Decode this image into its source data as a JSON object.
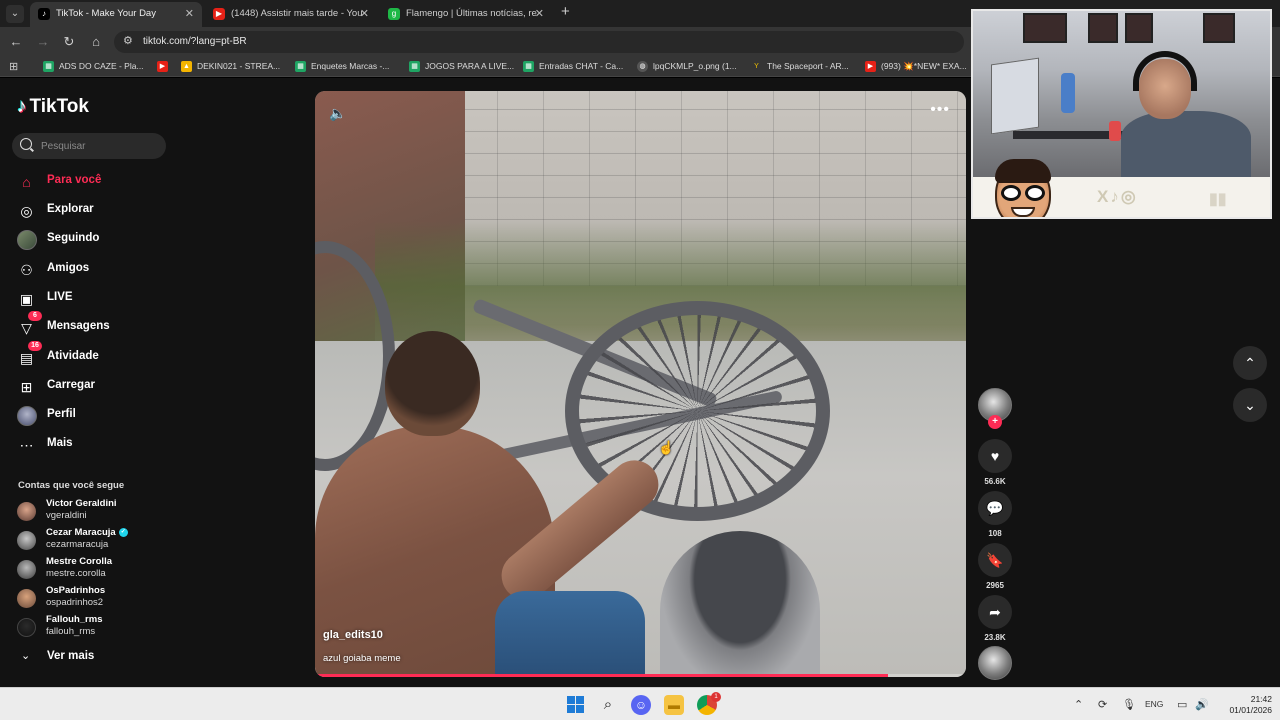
{
  "browser": {
    "tabs": [
      {
        "title": "TikTok - Make Your Day",
        "active": true,
        "favicon": "tiktok-icon"
      },
      {
        "title": "(1448) Assistir mais tarde - You",
        "active": false,
        "favicon": "youtube-icon"
      },
      {
        "title": "Flamengo | Últimas notícias, re",
        "active": false,
        "favicon": "ge-icon"
      }
    ],
    "url": "tiktok.com/?lang=pt-BR",
    "bookmarks": [
      {
        "label": "ADS DO CAZE - Pla...",
        "icon": "sheets-icon"
      },
      {
        "label": "",
        "icon": "youtube-icon"
      },
      {
        "label": "DEKIN021 - STREA...",
        "icon": "drive-icon"
      },
      {
        "label": "Enquetes Marcas -...",
        "icon": "sheets-icon"
      },
      {
        "label": "JOGOS PARA A LIVE...",
        "icon": "sheets-icon"
      },
      {
        "label": "Entradas CHAT - Ca...",
        "icon": "sheets-icon"
      },
      {
        "label": "lpqCKMLP_o.png (1...",
        "icon": "globe-icon"
      },
      {
        "label": "The Spaceport - AR...",
        "icon": "spaceport-icon"
      },
      {
        "label": "(993) 💥*NEW* EXA...",
        "icon": "youtube-icon"
      }
    ]
  },
  "tiktok": {
    "logo": "TikTok",
    "search_placeholder": "Pesquisar",
    "nav": [
      {
        "label": "Para você",
        "icon": "home-icon",
        "active": true
      },
      {
        "label": "Explorar",
        "icon": "compass-icon"
      },
      {
        "label": "Seguindo",
        "icon": "following-avatar"
      },
      {
        "label": "Amigos",
        "icon": "friends-icon"
      },
      {
        "label": "LIVE",
        "icon": "live-icon"
      },
      {
        "label": "Mensagens",
        "icon": "messages-icon",
        "badge": "6"
      },
      {
        "label": "Atividade",
        "icon": "activity-icon",
        "badge": "16"
      },
      {
        "label": "Carregar",
        "icon": "upload-icon"
      },
      {
        "label": "Perfil",
        "icon": "profile-avatar"
      },
      {
        "label": "Mais",
        "icon": "more-icon"
      }
    ],
    "following_title": "Contas que você segue",
    "following": [
      {
        "name": "Victor Geraldini",
        "user": "vgeraldini",
        "verified": false
      },
      {
        "name": "Cezar Maracuja",
        "user": "cezarmaracuja",
        "verified": true
      },
      {
        "name": "Mestre Corolla",
        "user": "mestre.corolla",
        "verified": false
      },
      {
        "name": "OsPadrinhos",
        "user": "ospadrinhos2",
        "verified": false
      },
      {
        "name": "Fallouh_rms",
        "user": "fallouh_rms",
        "verified": false
      }
    ],
    "see_more": "Ver mais",
    "video": {
      "author": "gla_edits10",
      "caption": "azul goiaba meme",
      "progress": 0.88
    },
    "actions": {
      "likes": "56.6K",
      "comments": "108",
      "saves": "2965",
      "shares": "23.8K"
    }
  },
  "taskbar": {
    "lang": "ENG",
    "time": "21:42",
    "date": "01/01/2026",
    "chrome_badge": "1"
  }
}
